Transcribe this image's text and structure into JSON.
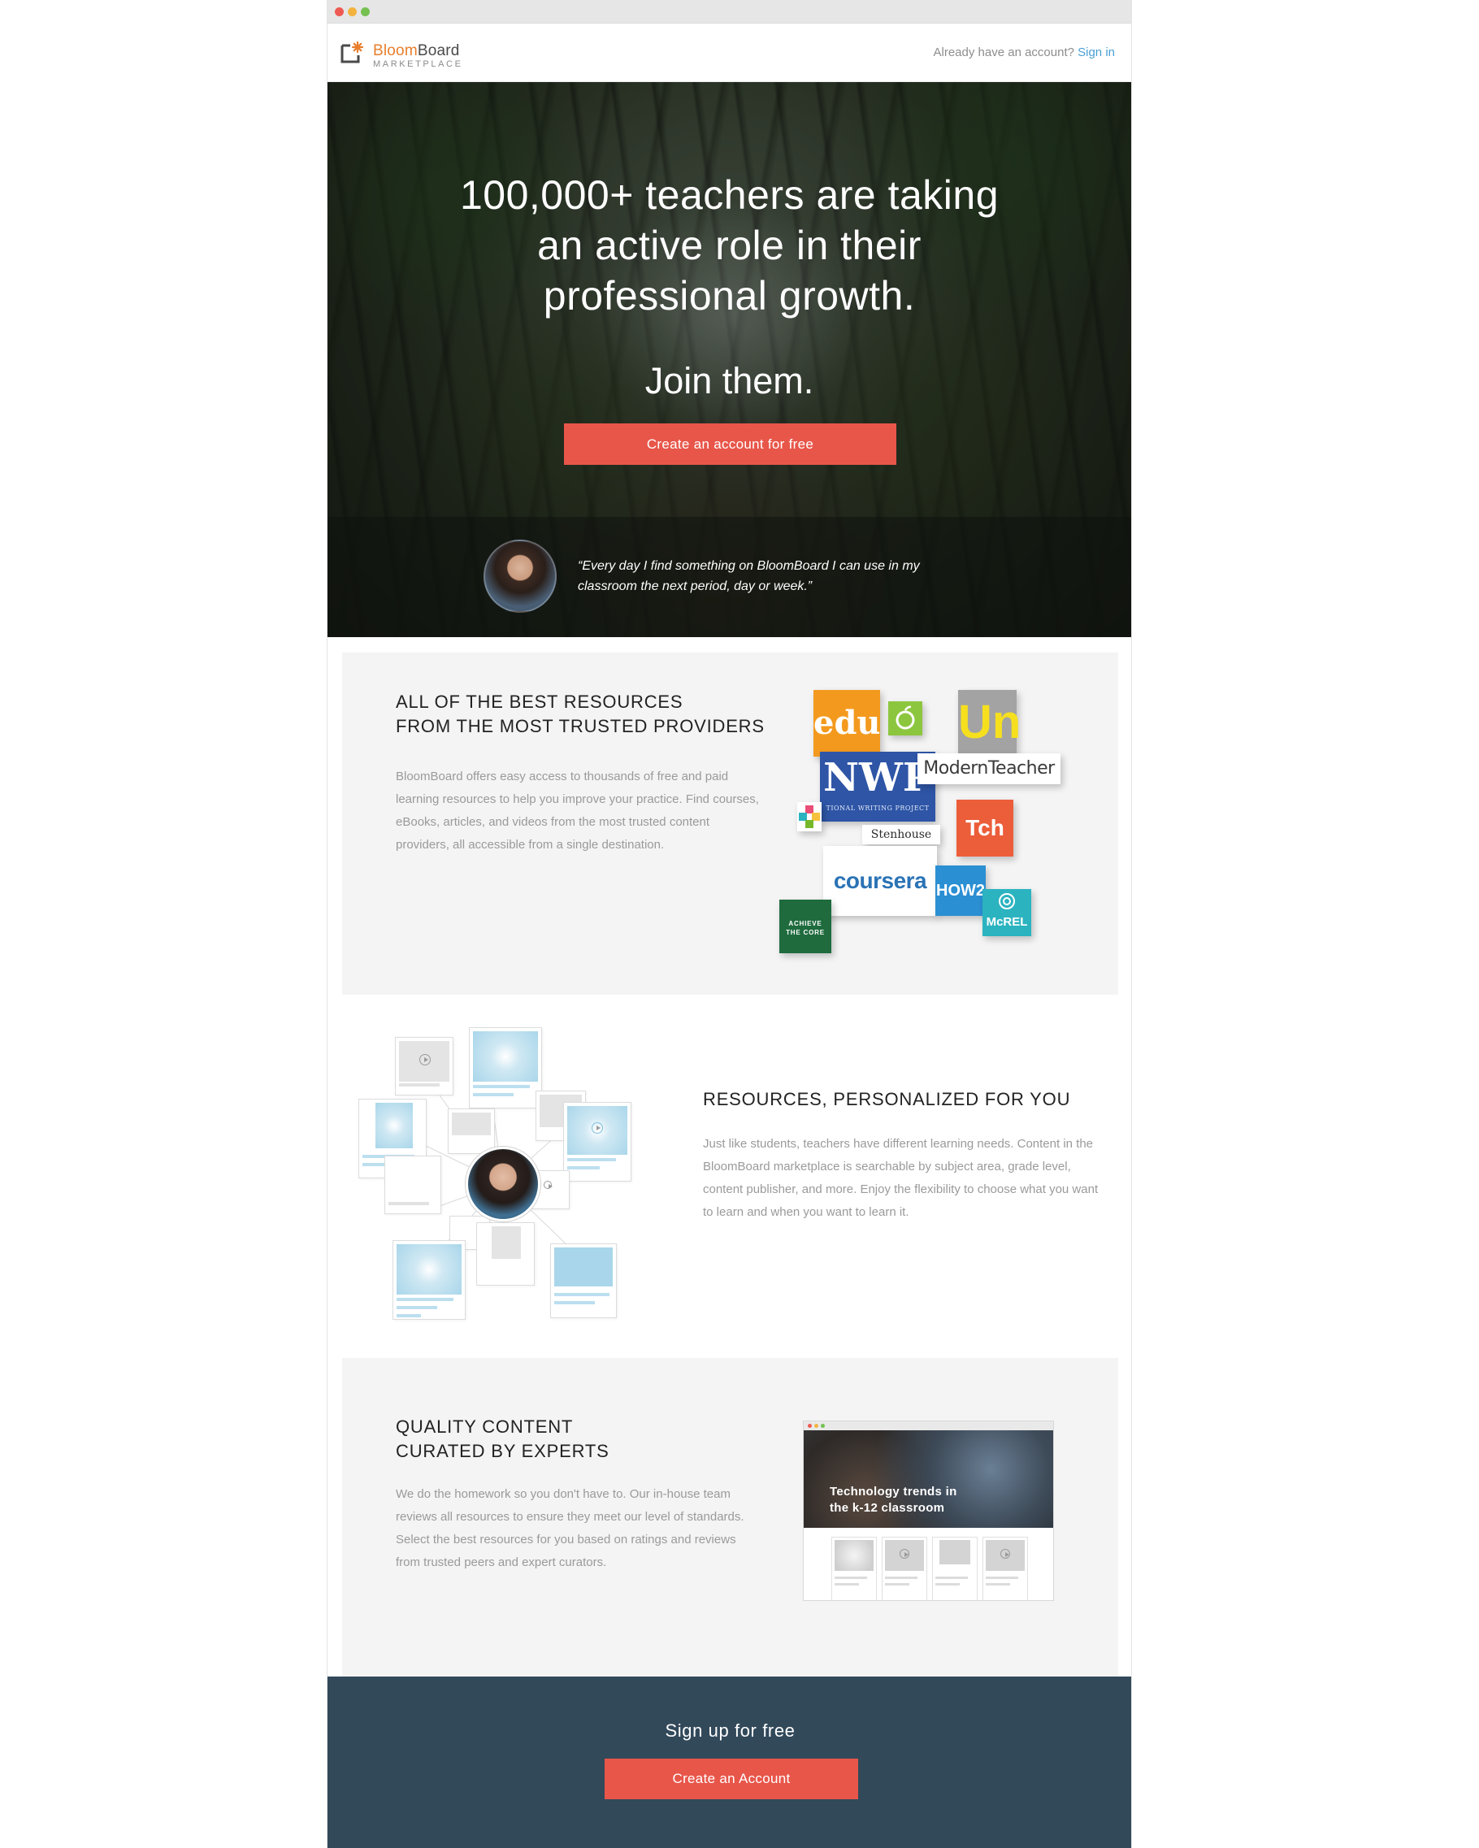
{
  "header": {
    "logo_brand_part1": "Bloom",
    "logo_brand_part2": "Board",
    "logo_sub": "MARKETPLACE",
    "account_prompt": "Already have an account?",
    "signin_label": "Sign in"
  },
  "hero": {
    "headline_line1": "100,000+ teachers are taking",
    "headline_line2": "an active role in their",
    "headline_line3": "professional growth.",
    "join": "Join them.",
    "cta_label": "Create an account for free",
    "quote_line1": "“Every day I find something on BloomBoard I can use in my",
    "quote_line2": "classroom the next period, day or week.”"
  },
  "providers": {
    "title_line1": "ALL OF THE BEST RESOURCES",
    "title_line2": "FROM THE MOST TRUSTED PROVIDERS",
    "body": "BloomBoard offers easy access to thousands of free and paid learning resources to help you improve your practice.  Find courses, eBooks, articles, and videos from the most trusted content providers, all accessible from a single destination.",
    "logos": {
      "edu": "edu",
      "un": "Un",
      "nwp": "NWP",
      "nwp_caption": "TIONAL WRITING PROJECT",
      "modernteacher": "ModernTeacher",
      "tch": "Tch",
      "stenhouse": "Stenhouse",
      "coursera": "coursera",
      "how2": "HOW2",
      "mcrel": "McREL",
      "achieve_line1": "ACHIEVE",
      "achieve_line2": "THE CORE"
    }
  },
  "personalized": {
    "title": "RESOURCES, PERSONALIZED FOR YOU",
    "body": "Just like students, teachers have different learning needs. Content in the BloomBoard marketplace is searchable by subject area, grade level, content publisher, and more.  Enjoy the flexibility to choose what you want to learn and when you want to learn it."
  },
  "quality": {
    "title_line1": "QUALITY CONTENT",
    "title_line2": "CURATED BY EXPERTS",
    "body": "We do the homework so you don't have to. Our in-house team reviews all resources to ensure they meet our level of standards. Select the best resources for you based on ratings and reviews from trusted peers and expert curators.",
    "mock_title_line1": "Technology trends in",
    "mock_title_line2": "the k-12 classroom"
  },
  "footer": {
    "title": "Sign up for free",
    "cta_label": "Create an Account"
  },
  "colors": {
    "accent": "#e8564a",
    "link": "#4a9fd4",
    "footer_bg": "#32495a",
    "section_bg": "#f4f4f4",
    "brand_orange": "#e87e2c"
  }
}
